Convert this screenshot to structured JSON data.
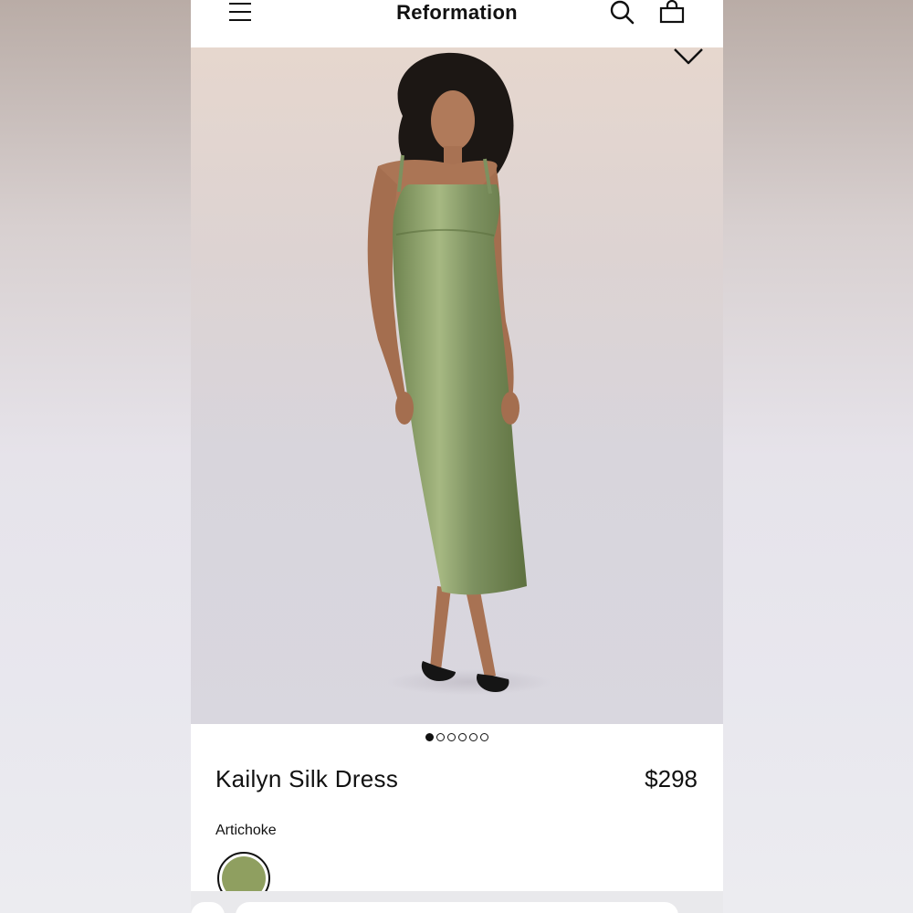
{
  "header": {
    "brand": "Reformation",
    "menu_icon": "hamburger-menu-icon",
    "search_icon": "search-icon",
    "bag_icon": "shopping-bag-icon"
  },
  "gallery": {
    "image": "product-photo-model-in-green-satin-slip-dress",
    "wishlist_icon": "heart-icon",
    "image_count": 6,
    "active_index": 1
  },
  "product": {
    "name": "Kailyn Silk Dress",
    "price": "$298",
    "color_name": "Artichoke",
    "swatch_color": "#8f9f60"
  },
  "colors": {
    "accent": "#111111",
    "dress": "#7f9360"
  }
}
